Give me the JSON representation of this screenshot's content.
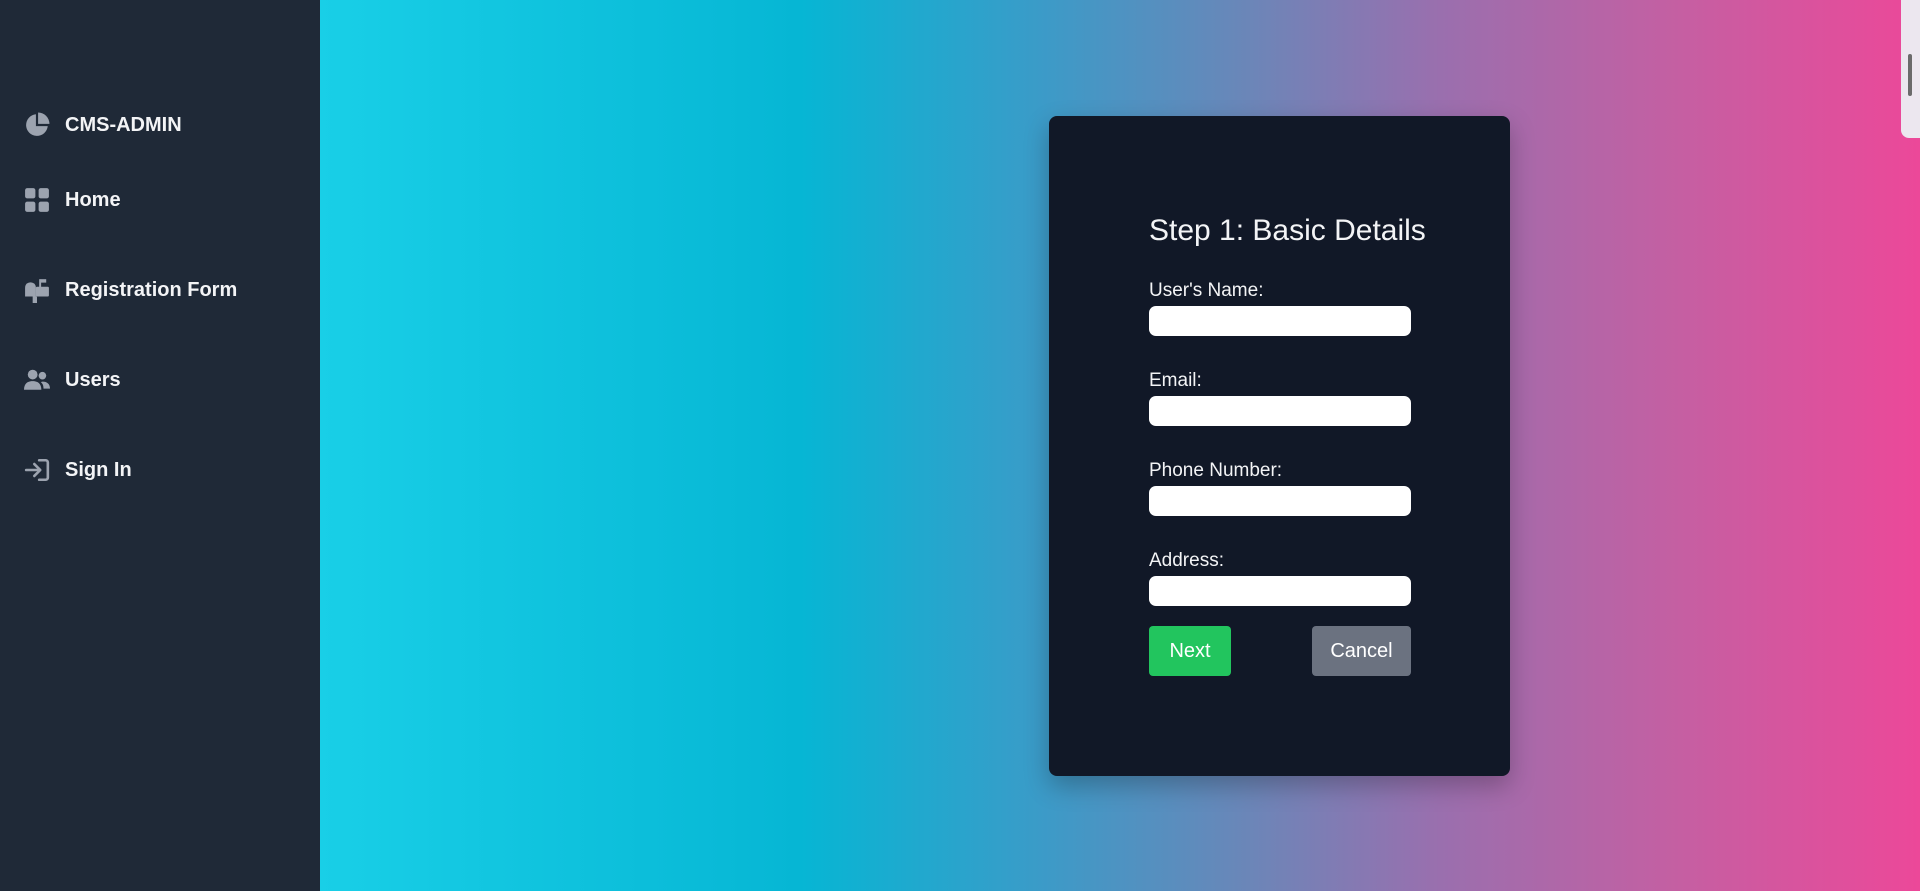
{
  "sidebar": {
    "items": [
      {
        "label": "CMS-ADMIN",
        "icon": "pie-chart-icon"
      },
      {
        "label": "Home",
        "icon": "grid-icon"
      },
      {
        "label": "Registration Form",
        "icon": "mailbox-icon"
      },
      {
        "label": "Users",
        "icon": "users-icon"
      },
      {
        "label": "Sign In",
        "icon": "sign-in-icon"
      }
    ]
  },
  "form": {
    "title": "Step 1: Basic Details",
    "fields": [
      {
        "label": "User's Name:",
        "value": ""
      },
      {
        "label": "Email:",
        "value": ""
      },
      {
        "label": "Phone Number:",
        "value": ""
      },
      {
        "label": "Address:",
        "value": ""
      }
    ],
    "next_label": "Next",
    "cancel_label": "Cancel"
  },
  "colors": {
    "sidebar_bg": "#1f2937",
    "card_bg": "#111827",
    "gradient_start": "#19cfe7",
    "gradient_end": "#ec4899",
    "next_button": "#22c55e",
    "cancel_button": "#6b7280"
  }
}
